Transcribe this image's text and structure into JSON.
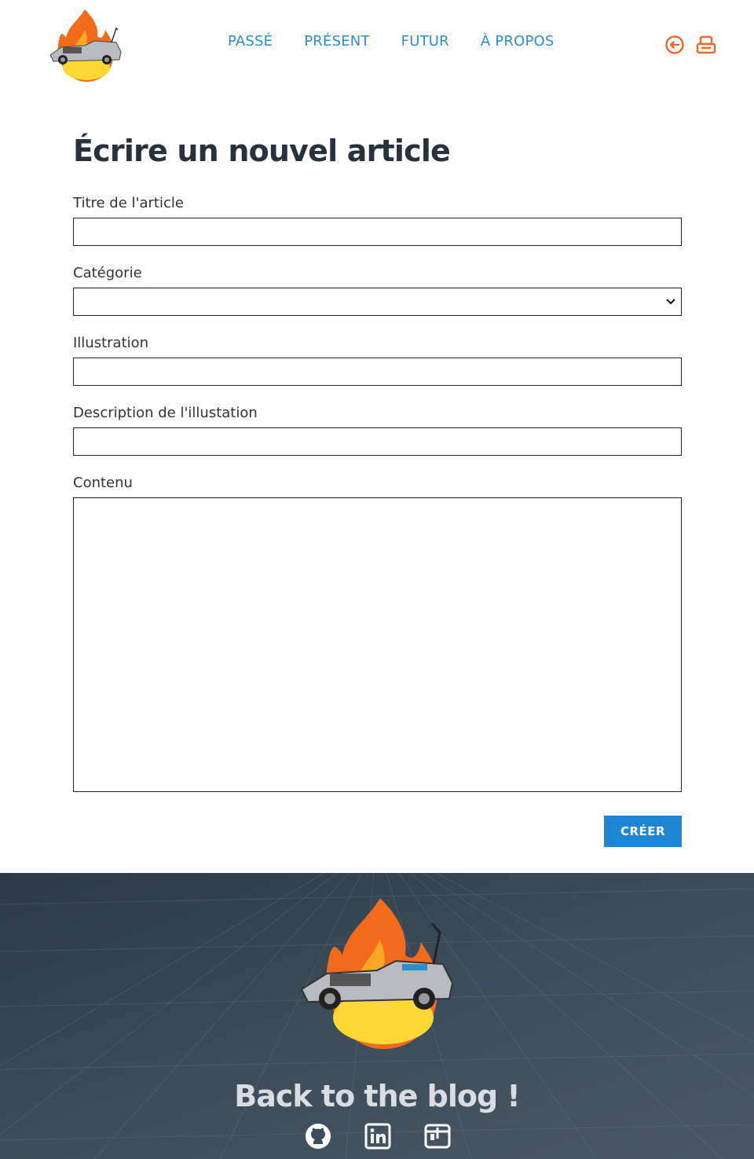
{
  "nav": {
    "items": [
      {
        "label": "PASSÉ"
      },
      {
        "label": "PRÉSENT"
      },
      {
        "label": "FUTUR"
      },
      {
        "label": "À PROPOS"
      }
    ]
  },
  "header_icons": [
    "logout-icon",
    "dashboard-icon"
  ],
  "form": {
    "title": "Écrire un nouvel article",
    "fields": {
      "title_label": "Titre de l'article",
      "title_value": "",
      "category_label": "Catégorie",
      "category_value": "",
      "illustration_label": "Illustration",
      "illustration_value": "",
      "illustration_desc_label": "Description de l'illustation",
      "illustration_desc_value": "",
      "content_label": "Contenu",
      "content_value": ""
    },
    "submit_label": "CRÉER"
  },
  "footer": {
    "title": "Back to the blog !",
    "icons": [
      "github-icon",
      "linkedin-icon",
      "malt-icon"
    ]
  },
  "colors": {
    "nav_link": "#2a8fd0",
    "accent_orange": "#e8692a",
    "button": "#1f86d6",
    "footer_bg": "#3b4b5a"
  }
}
